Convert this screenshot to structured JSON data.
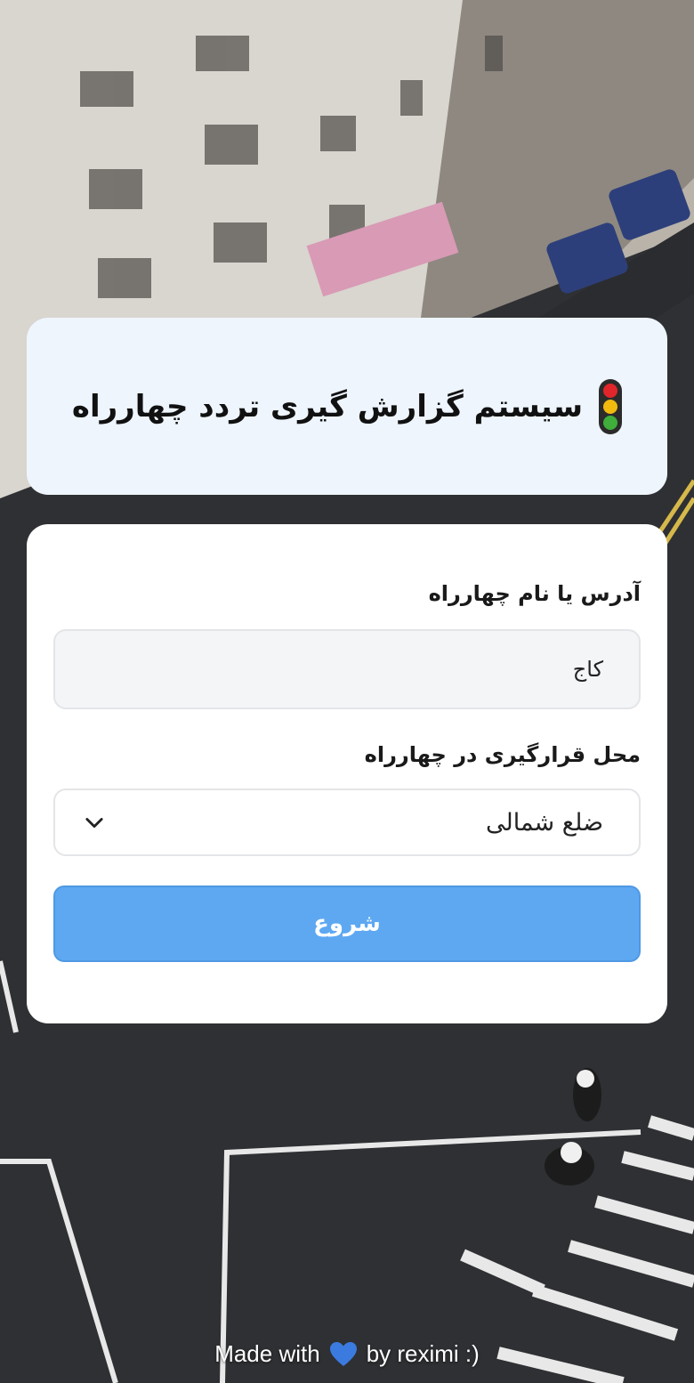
{
  "header": {
    "title": "سیستم گزارش گیری تردد چهارراه",
    "icon": "traffic-light-icon",
    "traffic_light_colors": [
      "#e0262b",
      "#f2b90f",
      "#3fae3a"
    ]
  },
  "form": {
    "address_label": "آدرس یا نام چهارراه",
    "address_value": "کاج",
    "position_label": "محل قرارگیری در چهارراه",
    "position_selected": "ضلع شمالی",
    "start_button_label": "شروع"
  },
  "footer": {
    "prefix": "Made with",
    "icon": "blue-heart-icon",
    "suffix": "by reximi :)"
  },
  "colors": {
    "title_card_bg": "#eef5fd",
    "button_bg": "#5ea8f2",
    "heart": "#3b7be0"
  }
}
